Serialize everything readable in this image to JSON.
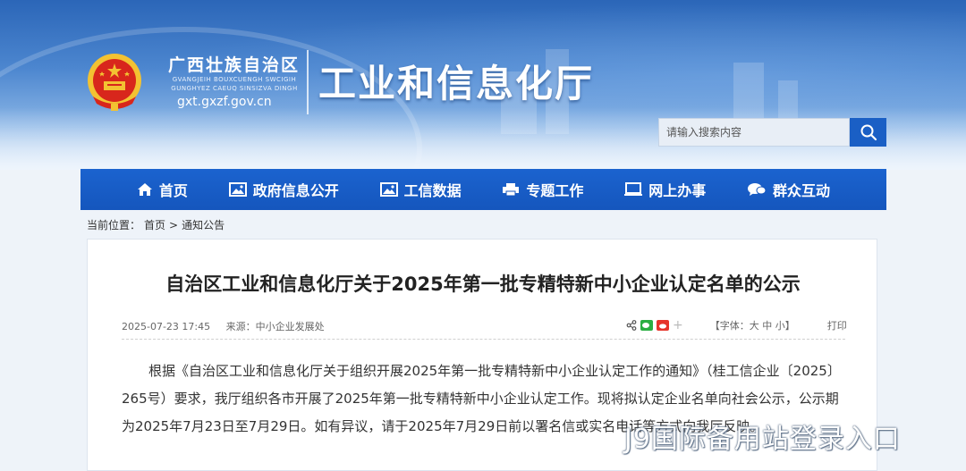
{
  "header": {
    "region_name": "广西壮族自治区",
    "region_zhuang": "GVANGJEIH BOUXCUENGH SWCIGIH GUNGHYEZ CAEUQ SINSIZVA DINGH",
    "site_url": "gxt.gxzf.gov.cn",
    "department": "工业和信息化厅"
  },
  "search": {
    "placeholder": "请输入搜索内容",
    "button_icon": "search-icon"
  },
  "nav": {
    "items": [
      {
        "label": "首页",
        "icon": "home-icon"
      },
      {
        "label": "政府信息公开",
        "icon": "image-icon"
      },
      {
        "label": "工信数据",
        "icon": "image-icon"
      },
      {
        "label": "专题工作",
        "icon": "printer-icon"
      },
      {
        "label": "网上办事",
        "icon": "monitor-icon"
      },
      {
        "label": "群众互动",
        "icon": "chat-icon"
      }
    ]
  },
  "breadcrumb": {
    "prefix": "当前位置：",
    "home": "首页",
    "sep": ">",
    "current": "通知公告"
  },
  "article": {
    "title": "自治区工业和信息化厅关于2025年第一批专精特新中小企业认定名单的公示",
    "datetime": "2025-07-23 17:45",
    "source": "来源：中小企业发展处",
    "font_size_label": "【字体：大 中 小】",
    "print_label": "打印",
    "body": "根据《自治区工业和信息化厅关于组织开展2025年第一批专精特新中小企业认定工作的通知》（桂工信企业〔2025〕265号）要求，我厅组织各市开展了2025年第一批专精特新中小企业认定工作。现将拟认定企业名单向社会公示，公示期为2025年7月23日至7月29日。如有异议，请于2025年7月29日前以署名信或实名电话等方式向我厅反映。"
  },
  "watermark": "J9国际备用站登录入口",
  "colors": {
    "nav_blue": "#1b63cf",
    "search_btn": "#1a5fc5",
    "emblem_red": "#d8261c",
    "emblem_gold": "#f3c232"
  }
}
